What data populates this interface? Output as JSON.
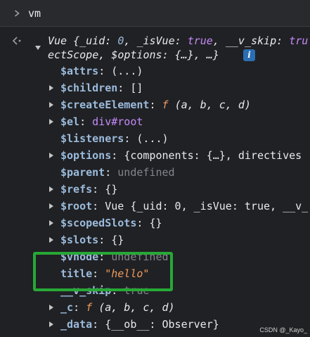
{
  "console_input": {
    "command": "vm"
  },
  "result": {
    "preview_line1": {
      "class_name": "Vue",
      "open_brace": "{",
      "uid_key": "_uid",
      "uid_val": "0",
      "isvue_key": "_isVue",
      "isvue_val": "true",
      "vskip_key": "__v_skip",
      "vskip_val": "tru"
    },
    "preview_line2": {
      "scope_tail": "ectScope,",
      "options_key": "$options",
      "options_val": "{…}",
      "ellipsis": "…}",
      "info_label": "i"
    },
    "props": [
      {
        "key": "$attrs",
        "value": "(...)",
        "expandable": false
      },
      {
        "key": "$children",
        "value": "[]",
        "expandable": true
      },
      {
        "key": "$createElement",
        "value_fn": "f",
        "value": "(a, b, c, d)",
        "expandable": true
      },
      {
        "key": "$el",
        "value": "div#root",
        "expandable": true
      },
      {
        "key": "$listeners",
        "value": "(...)",
        "expandable": false
      },
      {
        "key": "$options",
        "value": "{components: {…}, directives",
        "expandable": true
      },
      {
        "key": "$parent",
        "value": "undefined",
        "expandable": false
      },
      {
        "key": "$refs",
        "value": "{}",
        "expandable": true
      },
      {
        "key": "$root",
        "value": "Vue  {_uid: 0, _isVue: true, __v_",
        "expandable": true
      },
      {
        "key": "$scopedSlots",
        "value": "{}",
        "expandable": true
      },
      {
        "key": "$slots",
        "value": "{}",
        "expandable": true
      },
      {
        "key": "$vnode",
        "value": "undefined",
        "expandable": false
      },
      {
        "key": "title",
        "value": "\"hello\"",
        "expandable": false
      },
      {
        "key": "__v_skip",
        "value": "true",
        "expandable": false
      },
      {
        "key": "_c",
        "value_fn": "f",
        "value": "(a, b, c, d)",
        "expandable": true
      },
      {
        "key": "_data",
        "value": "{__ob__: Observer}",
        "expandable": true
      }
    ]
  },
  "watermark": "CSDN @_Kayo_"
}
